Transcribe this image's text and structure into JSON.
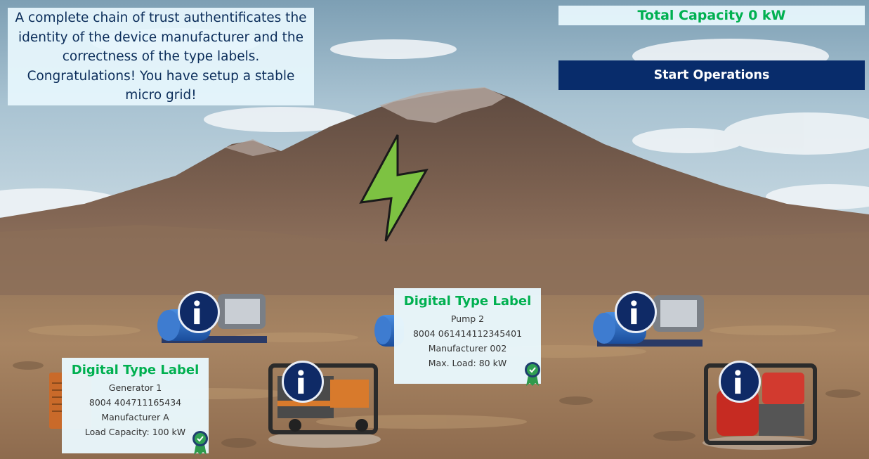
{
  "message": {
    "lines": [
      "A complete chain of trust authentificates the",
      "identity of the device manufacturer and the",
      "correctness of the type labels.",
      "Congratulations! You have setup a stable",
      "micro grid!"
    ]
  },
  "capacity": {
    "label": "Total Capacity 0 kW"
  },
  "start_button": {
    "label": "Start Operations"
  },
  "labels": [
    {
      "title": "Digital Type Label",
      "name": "Generator 1",
      "id": "8004 404711165434",
      "manufacturer": "Manufacturer A",
      "spec": "Load Capacity: 100 kW"
    },
    {
      "title": "Digital Type Label",
      "name": "Pump 2",
      "id": "8004 061414112345401",
      "manufacturer": "Manufacturer 002",
      "spec": "Max. Load: 80 kW"
    }
  ],
  "colors": {
    "accent_green": "#00b050",
    "navy": "#082c6b",
    "panel": "#e6f6fc",
    "info_blue": "#0f2a66",
    "bolt_green": "#7dc242"
  },
  "icons": [
    "lightning-bolt-icon",
    "info-icon",
    "verified-seal-icon",
    "pump-icon",
    "generator-icon"
  ]
}
